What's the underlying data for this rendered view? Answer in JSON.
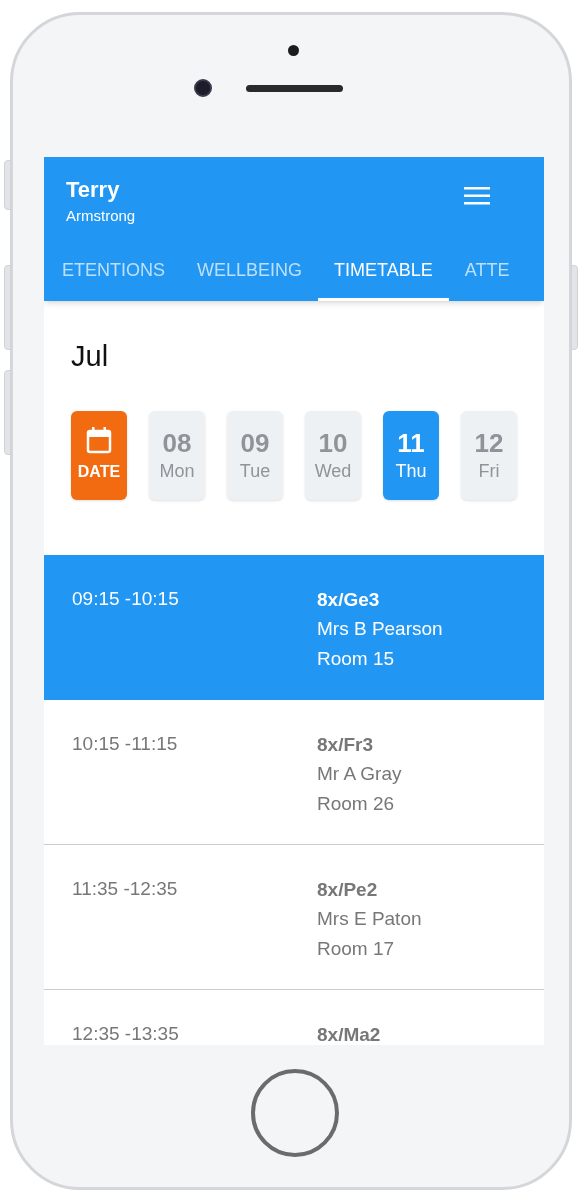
{
  "header": {
    "first_name": "Terry",
    "last_name": "Armstrong"
  },
  "tabs": [
    {
      "label": "ETENTIONS",
      "selected": false
    },
    {
      "label": "WELLBEING",
      "selected": false
    },
    {
      "label": "TIMETABLE",
      "selected": true
    },
    {
      "label": "ATTE",
      "selected": false
    }
  ],
  "month": "Jul",
  "days": [
    {
      "kind": "picker",
      "label": "DATE",
      "selected": false
    },
    {
      "kind": "day",
      "number": "08",
      "weekday": "Mon",
      "selected": false
    },
    {
      "kind": "day",
      "number": "09",
      "weekday": "Tue",
      "selected": false
    },
    {
      "kind": "day",
      "number": "10",
      "weekday": "Wed",
      "selected": false
    },
    {
      "kind": "day",
      "number": "11",
      "weekday": "Thu",
      "selected": true
    },
    {
      "kind": "day",
      "number": "12",
      "weekday": "Fri",
      "selected": false
    }
  ],
  "lessons": [
    {
      "time": "09:15 -10:15",
      "class": "8x/Ge3",
      "teacher": "Mrs B Pearson",
      "room": "Room 15",
      "selected": true
    },
    {
      "time": "10:15 -11:15",
      "class": "8x/Fr3",
      "teacher": "Mr A Gray",
      "room": "Room 26",
      "selected": false
    },
    {
      "time": "11:35 -12:35",
      "class": "8x/Pe2",
      "teacher": "Mrs E Paton",
      "room": "Room 17",
      "selected": false
    },
    {
      "time": "12:35 -13:35",
      "class": "8x/Ma2",
      "selected": false
    }
  ]
}
